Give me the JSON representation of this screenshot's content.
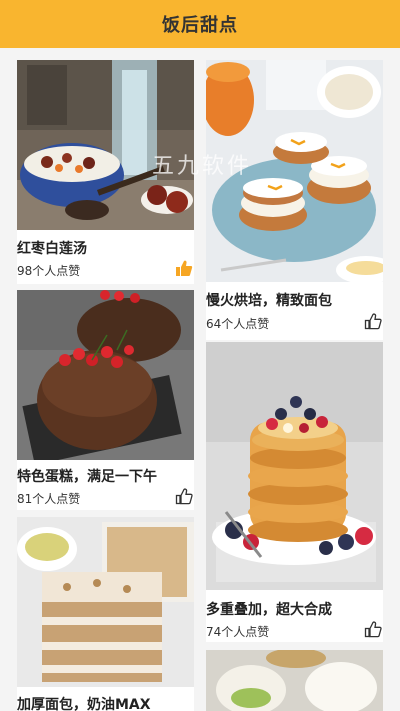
{
  "header": {
    "title": "饭后甜点"
  },
  "watermark": "五九软件",
  "cards": [
    {
      "title": "红枣白莲汤",
      "likes": "98个人点赞",
      "liked": true
    },
    {
      "title": "慢火烘培，精致面包",
      "likes": "64个人点赞",
      "liked": false
    },
    {
      "title": "特色蛋糕，满足一下午",
      "likes": "81个人点赞",
      "liked": false
    },
    {
      "title": "多重叠加，超大合成",
      "likes": "74个人点赞",
      "liked": false
    },
    {
      "title": "加厚面包，奶油MAX",
      "likes": "",
      "liked": false
    }
  ],
  "colors": {
    "accent": "#f9b52f",
    "liked_icon": "#f6a623",
    "icon": "#333333"
  }
}
